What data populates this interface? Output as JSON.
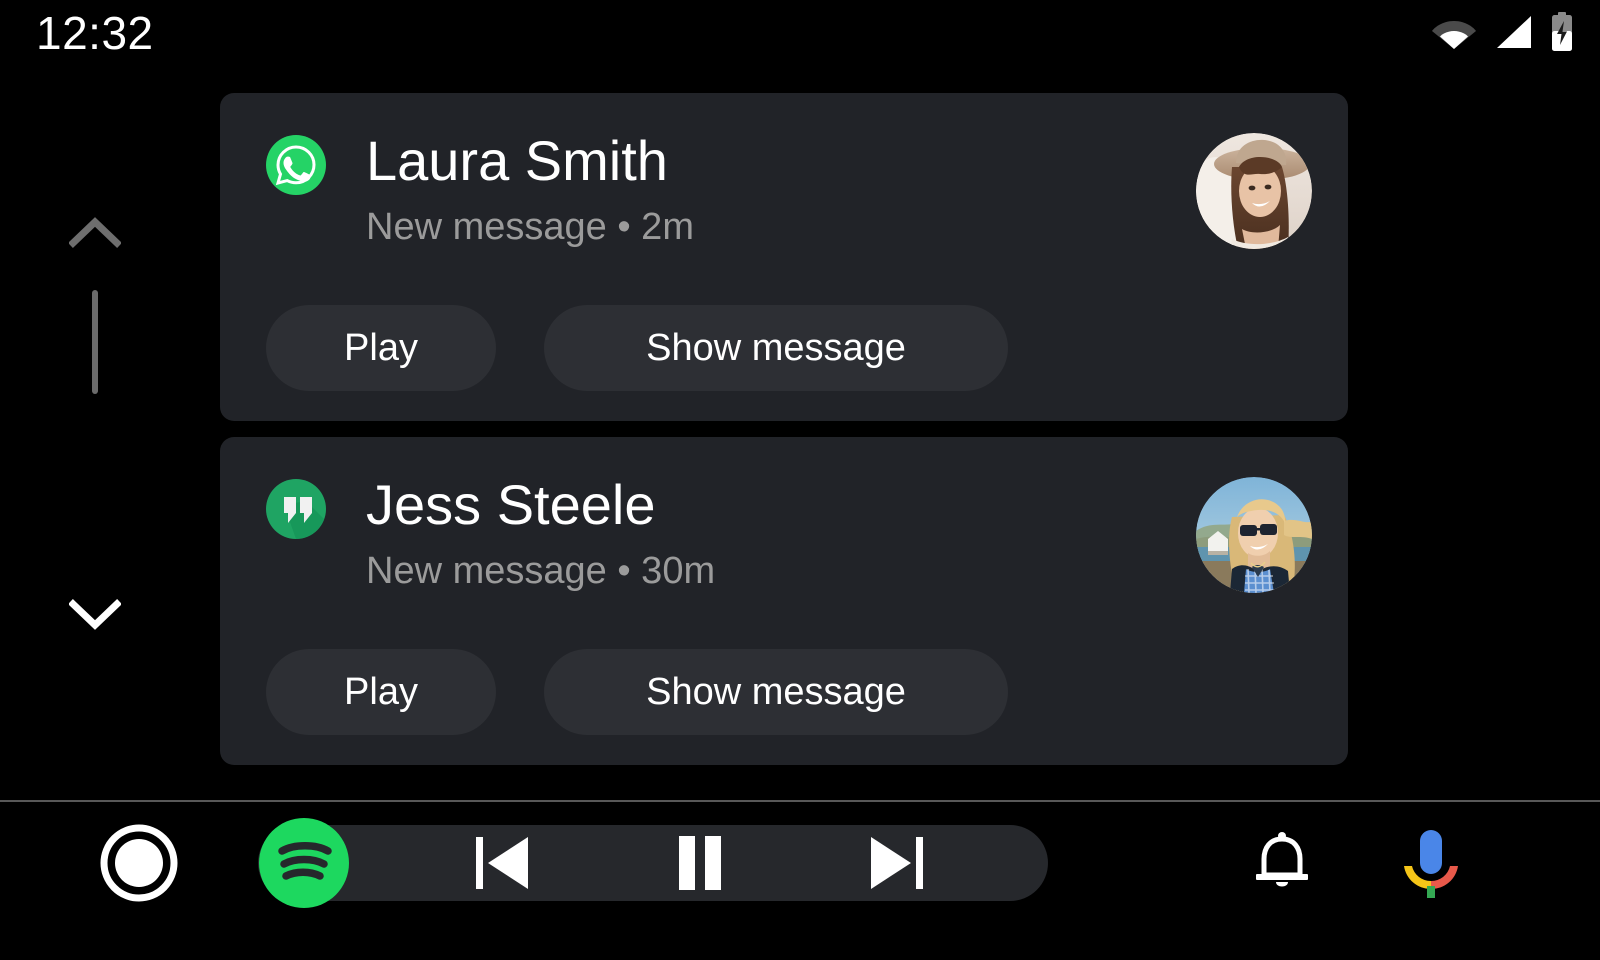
{
  "status_bar": {
    "clock": "12:32",
    "icons": [
      {
        "name": "wifi-icon",
        "label": "Wi-Fi"
      },
      {
        "name": "cellular-signal-icon",
        "label": "Cellular signal"
      },
      {
        "name": "battery-charging-icon",
        "label": "Battery charging"
      }
    ]
  },
  "scroll": {
    "up_icon": "chevron-up-icon",
    "down_icon": "chevron-down-icon",
    "thumb": "scrollbar-thumb"
  },
  "notifications": [
    {
      "app_icon": "whatsapp-icon",
      "app_name": "WhatsApp",
      "sender": "Laura Smith",
      "subtitle": "New message • 2m",
      "message_status": "New message",
      "time_ago": "2m",
      "avatar": "avatar-laura-smith",
      "actions": [
        {
          "name": "play-button",
          "label": "Play"
        },
        {
          "name": "show-message-button",
          "label": "Show message"
        }
      ]
    },
    {
      "app_icon": "hangouts-icon",
      "app_name": "Hangouts",
      "sender": "Jess Steele",
      "subtitle": "New message • 30m",
      "message_status": "New message",
      "time_ago": "30m",
      "avatar": "avatar-jess-steele",
      "actions": [
        {
          "name": "play-button",
          "label": "Play"
        },
        {
          "name": "show-message-button",
          "label": "Show message"
        }
      ]
    }
  ],
  "bottom_bar": {
    "home": {
      "name": "home-button",
      "label": "Home"
    },
    "media_app": {
      "name": "spotify-icon",
      "label": "Spotify"
    },
    "controls": [
      {
        "name": "previous-track-button",
        "label": "Previous"
      },
      {
        "name": "pause-button",
        "label": "Pause"
      },
      {
        "name": "next-track-button",
        "label": "Next"
      }
    ],
    "notifications_button": {
      "name": "bell-icon",
      "label": "Notifications"
    },
    "assistant_button": {
      "name": "google-assistant-mic-icon",
      "label": "Google Assistant"
    }
  },
  "colors": {
    "background": "#000000",
    "card": "#212328",
    "action_button": "#2d2f34",
    "media_pill": "#26282c",
    "text_primary": "#ffffff",
    "text_secondary": "#9b9b9b",
    "whatsapp_green": "#25d366",
    "hangouts_green": "#0f9d58",
    "spotify_green": "#1dd85f",
    "divider": "#585858"
  }
}
